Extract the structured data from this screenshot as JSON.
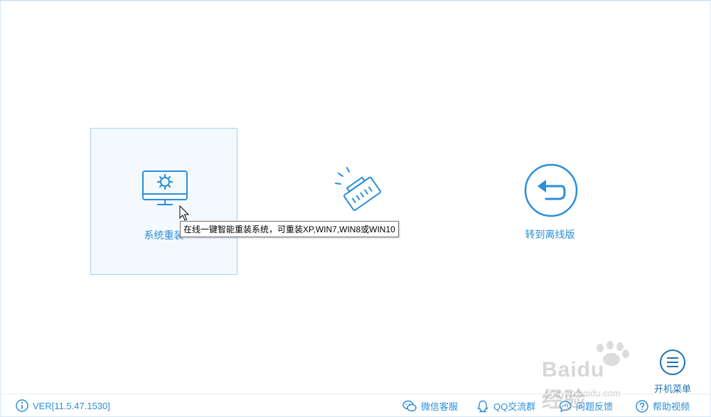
{
  "cards": [
    {
      "label": "系统重装",
      "icon": "monitor-gear-icon",
      "selected": true
    },
    {
      "label": "",
      "icon": "network-plug-icon",
      "selected": false
    },
    {
      "label": "转到离线版",
      "icon": "back-arrow-circle-icon",
      "selected": false
    }
  ],
  "tooltip": {
    "text": "在线一键智能重装系统，可重装XP,WIN7,WIN8或WIN10"
  },
  "menu": {
    "label": "开机菜单",
    "icon": "menu-circle-icon"
  },
  "footer": {
    "version": "VER[11.5.47.1530]",
    "wechat": "微信客服",
    "qq": "QQ交流群",
    "feedback": "问题反馈",
    "help": "帮助视频"
  },
  "watermark": {
    "brand": "Baidu经验",
    "url": "jingyan.baidu.com"
  },
  "colors": {
    "accent": "#2a8fd8",
    "selected_bg": "#f4f9fe",
    "selected_border": "#a9d2f0"
  }
}
